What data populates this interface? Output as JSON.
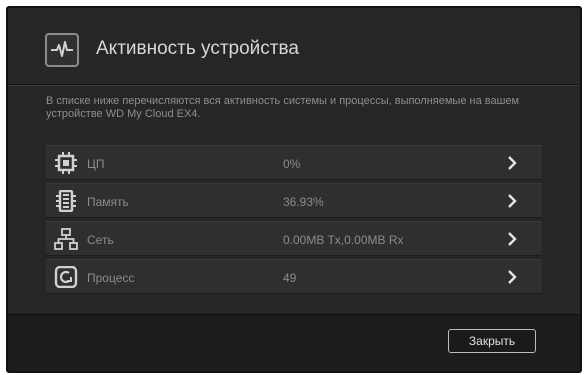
{
  "dialog": {
    "title": "Активность устройства",
    "description": "В списке ниже перечисляются вся активность системы и процессы, выполняемые на вашем устройстве WD My Cloud EX4.",
    "header_icon": "activity-pulse-icon"
  },
  "rows": [
    {
      "label": "ЦП",
      "value": "0%",
      "icon": "cpu-chip-icon"
    },
    {
      "label": "Память",
      "value": "36.93%",
      "icon": "memory-module-icon"
    },
    {
      "label": "Сеть",
      "value": "0.00MB Tx,0.00MB Rx",
      "icon": "network-icon"
    },
    {
      "label": "Процесс",
      "value": "49",
      "icon": "process-icon"
    }
  ],
  "footer": {
    "close_label": "Закрыть"
  },
  "colors": {
    "dialog_background": "#262626",
    "row_background": "#2f2f2f",
    "footer_background": "#1c1c1c",
    "text_muted": "#8b8b8b"
  }
}
